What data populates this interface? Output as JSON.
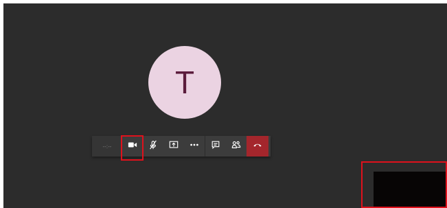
{
  "participant": {
    "initial": "T"
  },
  "toolbar": {
    "call_timer": "--:--",
    "buttons": [
      "camera-icon",
      "mic-off-icon",
      "share-screen-icon",
      "more-icon",
      "chat-icon",
      "people-icon",
      "hang-up-icon"
    ]
  },
  "colors": {
    "stage_background": "#2c2c2c",
    "avatar_fill": "#ebd3e2",
    "avatar_text": "#5b1c3c",
    "hang_up": "#a4262c",
    "annotation_box": "#e0111c"
  }
}
